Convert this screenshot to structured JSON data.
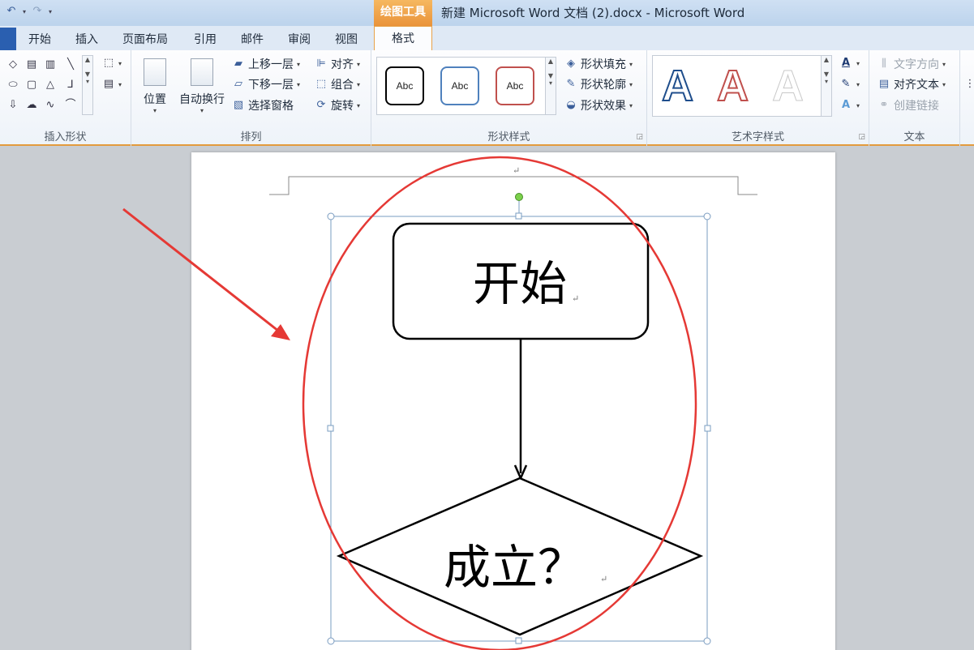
{
  "quick_access": {
    "undo_icon": "undo-icon",
    "redo_icon": "redo-icon",
    "customize_icon": "customize-qat-icon"
  },
  "window": {
    "title": "新建 Microsoft Word 文档 (2).docx - Microsoft Word"
  },
  "contextual_tab_group": {
    "label": "绘图工具",
    "color": "#e9933a"
  },
  "tabs": [
    {
      "label": "开始"
    },
    {
      "label": "插入"
    },
    {
      "label": "页面布局"
    },
    {
      "label": "引用"
    },
    {
      "label": "邮件"
    },
    {
      "label": "审阅"
    },
    {
      "label": "视图"
    },
    {
      "label": "格式",
      "active": true
    }
  ],
  "ribbon": {
    "insert_shapes": {
      "label": "插入形状"
    },
    "arrange": {
      "label": "排列",
      "position": "位置",
      "wrap_text": "自动换行",
      "bring_forward": "上移一层",
      "send_backward": "下移一层",
      "selection_pane": "选择窗格",
      "align": "对齐",
      "group": "组合",
      "rotate": "旋转"
    },
    "shape_styles": {
      "label": "形状样式",
      "swatch_text": "Abc",
      "swatch_colors": [
        "#000000",
        "#4f81bd",
        "#c0504d"
      ],
      "fill": "形状填充",
      "outline": "形状轮廓",
      "effects": "形状效果"
    },
    "wordart_styles": {
      "label": "艺术字样式",
      "letter": "A",
      "text_fill_icon": "text-fill-icon",
      "text_outline_icon": "text-outline-icon",
      "text_effects_icon": "text-effects-icon"
    },
    "text": {
      "label": "文本",
      "direction": "文字方向",
      "align_text": "对齐文本",
      "create_link": "创建链接"
    }
  },
  "document": {
    "paragraph_mark": "↵",
    "flowchart": {
      "start_label": "开始",
      "decision_label": "成立？"
    },
    "annotation": {
      "circle_color": "#e53935",
      "arrow_color": "#e53935"
    }
  }
}
